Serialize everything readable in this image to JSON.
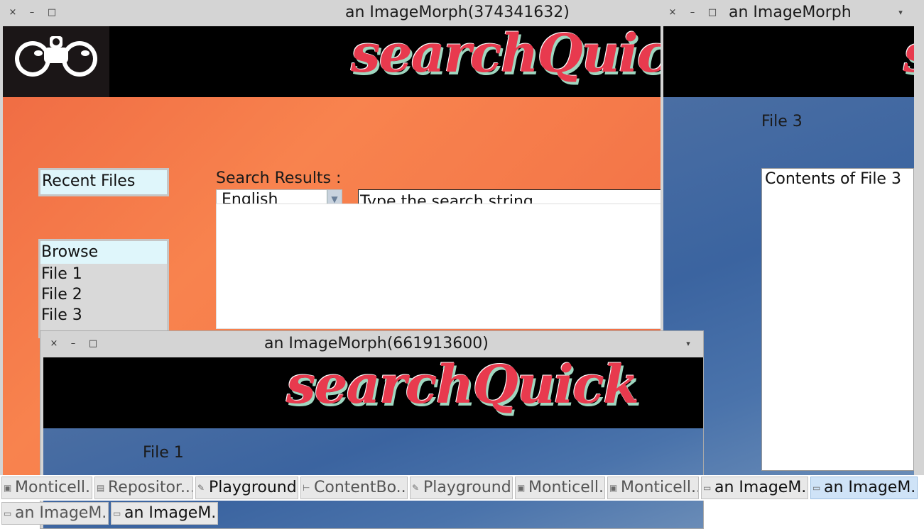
{
  "window_main": {
    "title": "an ImageMorph(374341632)",
    "close": "×",
    "minimize": "–",
    "maximize": "□",
    "wordmark": "searchQuick",
    "language": "English",
    "search_placeholder": "Type the search string ...",
    "recent_files_label": "Recent Files",
    "search_results_label": "Search Results :",
    "browse_label": "Browse",
    "files": [
      "File 1",
      "File 2",
      "File 3"
    ]
  },
  "window_right": {
    "title": "an ImageMorph",
    "close": "×",
    "minimize": "–",
    "maximize": "□",
    "menu": "▾",
    "wordmark": "searchQuick",
    "file_label": "File 3",
    "contents": "Contents of File 3"
  },
  "window_bottom": {
    "title": "an ImageMorph(661913600)",
    "close": "×",
    "minimize": "–",
    "maximize": "□",
    "menu": "▾",
    "wordmark": "searchQuick",
    "file_label": "File 1"
  },
  "taskbar_row1": [
    {
      "label": "Monticell...",
      "icon": "package-icon"
    },
    {
      "label": "Repositor...",
      "icon": "repository-icon"
    },
    {
      "label": "Playground",
      "icon": "edit-icon"
    },
    {
      "label": "ContentBo...",
      "icon": "hierarchy-icon"
    },
    {
      "label": "Playground",
      "icon": "edit-icon"
    },
    {
      "label": "Monticell...",
      "icon": "package-icon"
    },
    {
      "label": "Monticell...",
      "icon": "package-icon"
    },
    {
      "label": "an ImageM...",
      "icon": "window-icon"
    },
    {
      "label": "an ImageM...",
      "icon": "window-icon"
    }
  ],
  "taskbar_row2": [
    {
      "label": "an ImageM...",
      "icon": "window-icon"
    },
    {
      "label": "an ImageM...",
      "icon": "window-icon"
    }
  ]
}
